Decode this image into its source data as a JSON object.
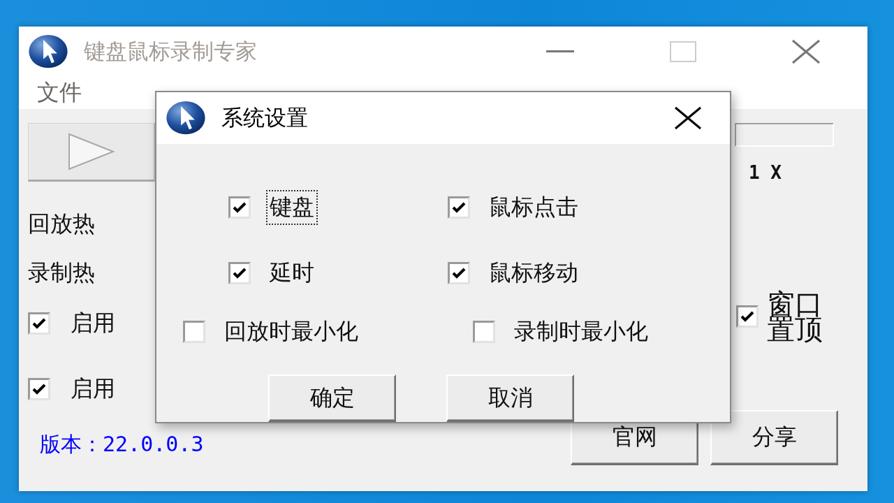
{
  "main_window": {
    "title": "键盘鼠标录制专家",
    "active": false,
    "menu": [
      "文件"
    ],
    "hotkey_labels": [
      "回放热",
      "录制热"
    ],
    "enable_options": [
      {
        "label": "启用",
        "checked": true
      },
      {
        "label": "启用",
        "checked": true
      }
    ],
    "speed": "1 X",
    "topmost": {
      "label": "窗口置顶",
      "checked": true
    },
    "version": "版本：22.0.0.3",
    "buttons": [
      "官网",
      "分享"
    ]
  },
  "dialog": {
    "title": "系统设置",
    "options": [
      {
        "label": "键盘",
        "checked": true,
        "focused": true
      },
      {
        "label": "鼠标点击",
        "checked": true,
        "focused": false
      },
      {
        "label": "延时",
        "checked": true,
        "focused": false
      },
      {
        "label": "鼠标移动",
        "checked": true,
        "focused": false
      },
      {
        "label": "回放时最小化",
        "checked": false,
        "focused": false
      },
      {
        "label": "录制时最小化",
        "checked": false,
        "focused": false
      }
    ],
    "buttons": [
      "确定",
      "取消"
    ]
  }
}
